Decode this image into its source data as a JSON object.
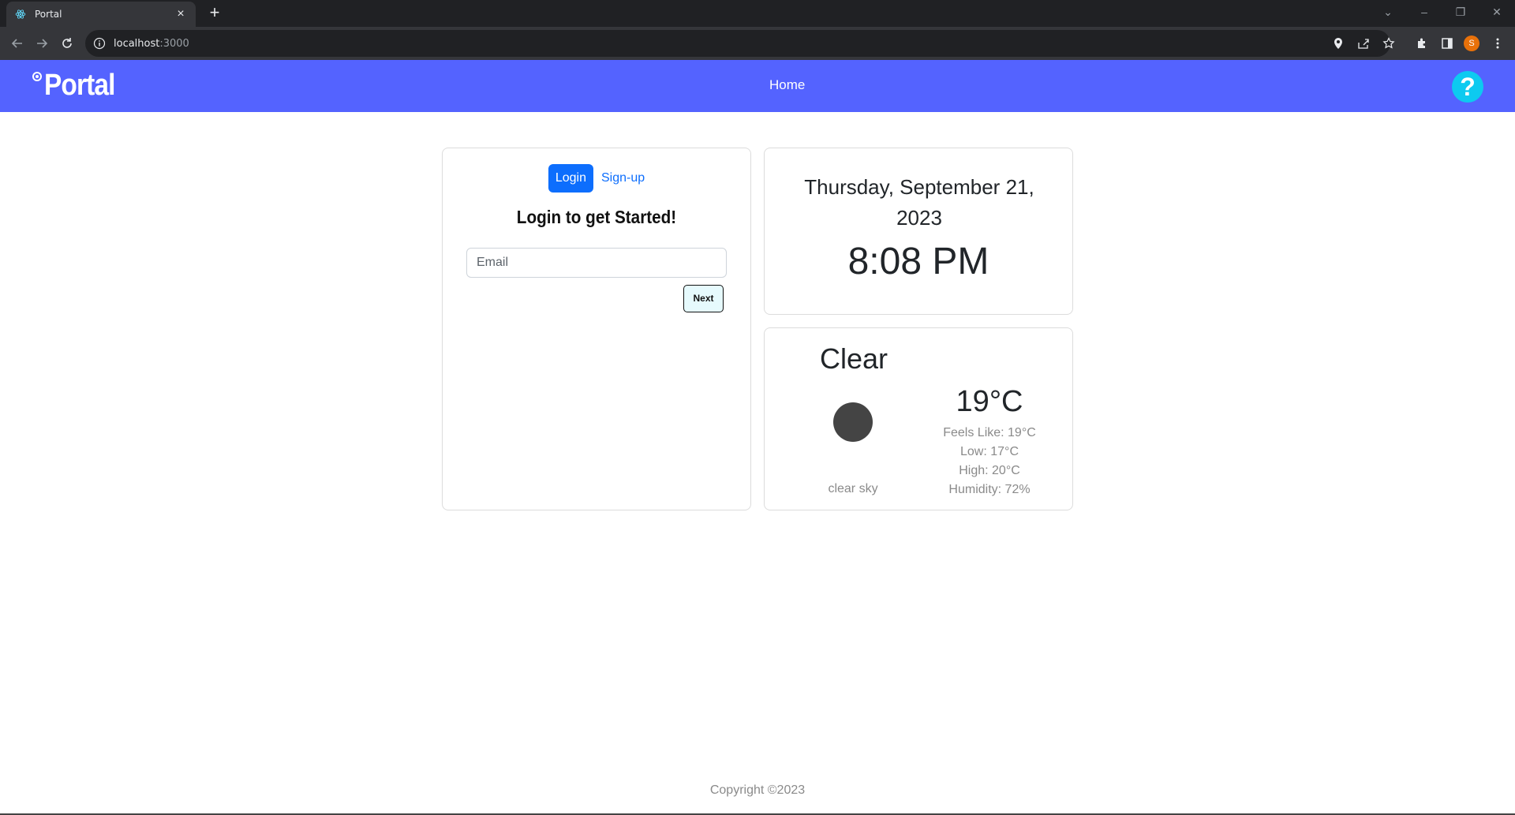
{
  "browser": {
    "tab_title": "Portal",
    "tab_close": "×",
    "new_tab": "+",
    "url_host": "localhost",
    "url_port": ":3000",
    "profile_initial": "S",
    "window_controls": [
      "⌄",
      "–",
      "❐",
      "✕"
    ]
  },
  "app": {
    "brand": "Portal",
    "nav_home": "Home",
    "help_symbol": "?",
    "colors": {
      "nav_bg": "#5463ff",
      "primary": "#0d6efd",
      "help": "#0dcaf0"
    }
  },
  "login": {
    "login_tab": "Login",
    "signup_tab": "Sign-up",
    "heading": "Login to get Started!",
    "email_placeholder": "Email",
    "email_value": "",
    "next_label": "Next"
  },
  "clock": {
    "date": "Thursday, September 21, 2023",
    "time": "8:08 PM"
  },
  "weather": {
    "condition": "Clear",
    "description": "clear sky",
    "icon": "clear-sky-icon",
    "temperature": "19°C",
    "feels_like": "Feels Like: 19°C",
    "low": "Low: 17°C",
    "high": "High: 20°C",
    "humidity": "Humidity: 72%"
  },
  "footer": {
    "copyright": "Copyright ©2023"
  }
}
